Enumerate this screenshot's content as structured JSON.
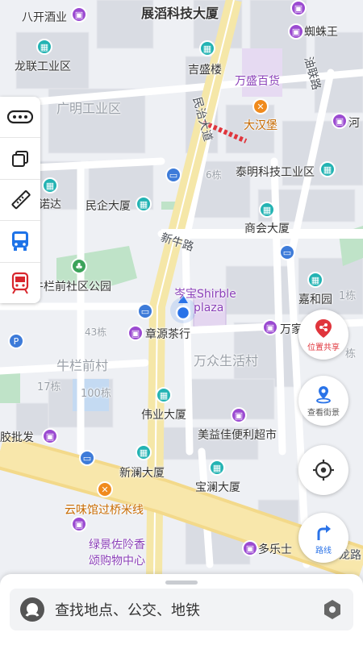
{
  "map": {
    "labels": {
      "bajiu": "八开酒业",
      "zhantao": "展滔科技大厦",
      "zhizhuwang": "蜘蛛王",
      "longlian": "龙联工业区",
      "jisheng": "吉盛楼",
      "wansheng": "万盛百货",
      "youlian": "油联路",
      "guangming": "广明工业区",
      "minzhi": "民治大道",
      "dahanbao": "大汉堡",
      "he": "河",
      "liudong": "6栋",
      "taiming": "泰明科技工业区",
      "nuoda": "诺达",
      "minqi": "民企大厦",
      "xinniu": "新牛路",
      "shanghui": "商会大厦",
      "niulanqian_park": "牛栏前社区公园",
      "cenbao": "岑宝Shirble",
      "plaza": "plaza",
      "jiahe": "嘉和园",
      "yidong": "1栋",
      "wanjia": "万家",
      "zhangyuan": "章源茶行",
      "sisandong": "43栋",
      "wanzhong": "万众生活村",
      "niulanqian_cun": "牛栏前村",
      "shiqidong": "17栋",
      "yibaidong": "100栋",
      "dong_right": "栋",
      "weiye": "伟业大厦",
      "jiaopi": "胶批发",
      "meiyijia": "美益佳便利超市",
      "xinlan": "新澜大厦",
      "baolan": "宝澜大厦",
      "yunwei": "云味馆过桥米线",
      "lvjing": "绿景佐阾香",
      "lvjing2": "颂购物中心",
      "duoleshi": "多乐士",
      "longlu": "龙路"
    }
  },
  "toolbar": {
    "items": [
      {
        "name": "more",
        "icon": "more-dots-icon"
      },
      {
        "name": "layers",
        "icon": "layers-icon"
      },
      {
        "name": "ruler",
        "icon": "ruler-icon"
      },
      {
        "name": "bus",
        "icon": "bus-icon"
      },
      {
        "name": "subway",
        "icon": "subway-icon"
      }
    ]
  },
  "actions": {
    "share_label": "位置共享",
    "street_view_label": "查看街景",
    "route_label": "路线"
  },
  "search": {
    "placeholder": "查找地点、公交、地铁"
  },
  "colors": {
    "road_yellow": "#f6e08a",
    "building": "#d7dae1",
    "park": "#bfe3c8",
    "water": "#b8d4f0",
    "accent_blue": "#2a73e8",
    "accent_red": "#e0353c"
  }
}
